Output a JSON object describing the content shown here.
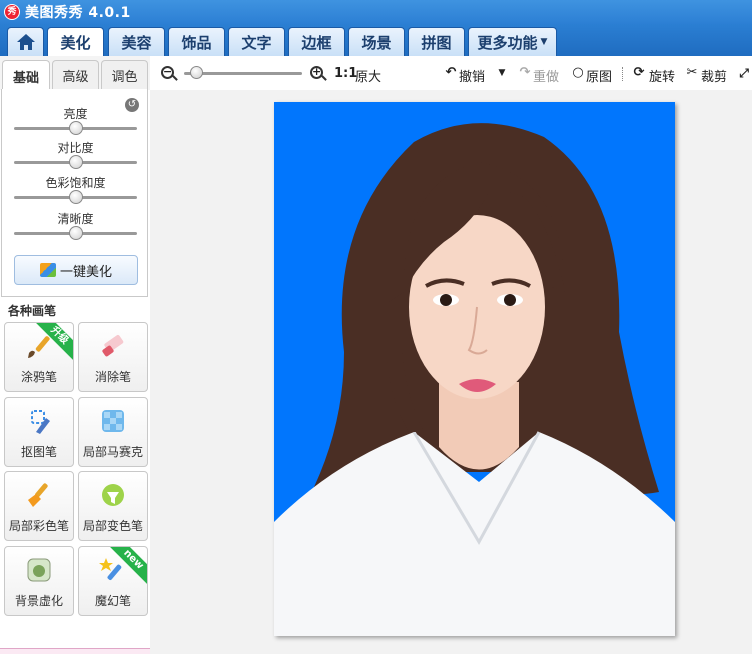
{
  "app": {
    "title": "美图秀秀 4.0.1",
    "logo_text": "秀"
  },
  "tabs": [
    {
      "label": "美化",
      "active": true
    },
    {
      "label": "美容"
    },
    {
      "label": "饰品"
    },
    {
      "label": "文字"
    },
    {
      "label": "边框"
    },
    {
      "label": "场景"
    },
    {
      "label": "拼图"
    },
    {
      "label": "更多功能"
    }
  ],
  "left_panel": {
    "subtabs": [
      "基础",
      "高级",
      "调色"
    ],
    "sliders": [
      {
        "label": "亮度",
        "value": 0.5
      },
      {
        "label": "对比度",
        "value": 0.5
      },
      {
        "label": "色彩饱和度",
        "value": 0.5
      },
      {
        "label": "清晰度",
        "value": 0.5
      }
    ],
    "auto_enhance_label": "一键美化",
    "brushes_title": "各种画笔",
    "brushes": [
      {
        "label": "涂鸦笔",
        "icon": "paintbrush-icon",
        "badge": "升级"
      },
      {
        "label": "消除笔",
        "icon": "eraser-icon"
      },
      {
        "label": "抠图笔",
        "icon": "cutout-pen-icon"
      },
      {
        "label": "局部马赛克",
        "icon": "mosaic-icon"
      },
      {
        "label": "局部彩色笔",
        "icon": "color-brush-icon"
      },
      {
        "label": "局部变色笔",
        "icon": "color-change-icon"
      },
      {
        "label": "背景虚化",
        "icon": "background-blur-icon"
      },
      {
        "label": "魔幻笔",
        "icon": "magic-pen-icon",
        "badge": "new"
      }
    ]
  },
  "toolbar": {
    "zoom_level": 0.1,
    "ratio_label": "1:1",
    "original_size_label": "原大",
    "undo_label": "撤销",
    "redo_label": "重做",
    "original_image_label": "原图",
    "rotate_label": "旋转",
    "crop_label": "裁剪"
  },
  "colors": {
    "photo_background": "#0176fd",
    "title_bar": "#2c7fd4",
    "badge_green": "#27b24a"
  }
}
